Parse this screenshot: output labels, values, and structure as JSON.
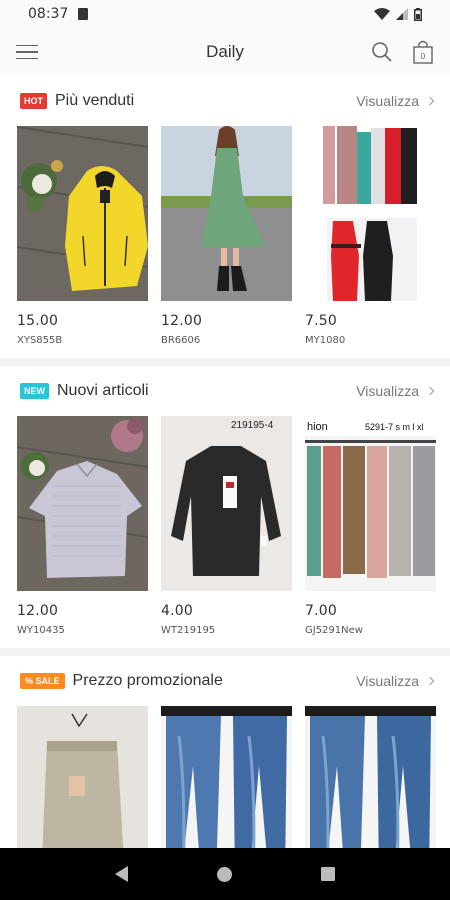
{
  "status": {
    "time": "08:37"
  },
  "header": {
    "title": "Daily"
  },
  "sections": [
    {
      "badge": "HOT",
      "title": "Più venduti",
      "view_all": "Visualizza",
      "products": [
        {
          "price": "15.00",
          "sku": "XYS855B"
        },
        {
          "price": "12.00",
          "sku": "BR6606"
        },
        {
          "price": "7.50",
          "sku": "MY1080"
        }
      ]
    },
    {
      "badge": "NEW",
      "title": "Nuovi articoli",
      "view_all": "Visualizza",
      "products": [
        {
          "price": "12.00",
          "sku": "WY10435"
        },
        {
          "price": "4.00",
          "sku": "WT219195"
        },
        {
          "price": "7.00",
          "sku": "GJ5291New"
        }
      ]
    },
    {
      "badge": "SALE",
      "title": "Prezzo promozionale",
      "view_all": "Visualizza",
      "products": [
        {
          "price": "",
          "sku": ""
        },
        {
          "price": "",
          "sku": ""
        },
        {
          "price": "",
          "sku": ""
        }
      ]
    }
  ],
  "image_text": {
    "code_a": "219195-4",
    "code_b": "5291-7 s m l xl",
    "code_c": "hion"
  },
  "colors": {
    "hot": "#e53935",
    "new": "#26c6da",
    "sale": "#ff8a1f"
  }
}
